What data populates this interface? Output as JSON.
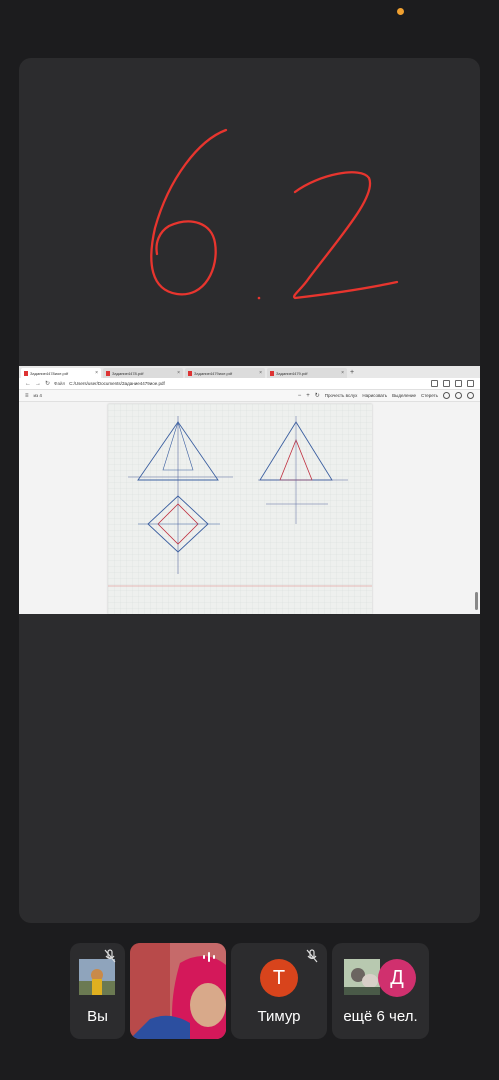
{
  "browser": {
    "tabs": [
      {
        "title": "Задание4478иое.pdf",
        "active": true
      },
      {
        "title": "Задание4478.pdf",
        "active": false
      },
      {
        "title": "Задание4479иое.pdf",
        "active": false
      },
      {
        "title": "Задание4479.pdf",
        "active": false
      }
    ],
    "address_label": "Файл",
    "address_url": "C:/Users/user/Documents/Задание4479иое.pdf",
    "pdf_toolbar": {
      "page_indicator": "из 4",
      "read_aloud": "Прочесть вслух",
      "draw": "Нарисовать",
      "highlight": "Выделение",
      "erase": "Стереть"
    }
  },
  "handwriting": {
    "text": "6 2",
    "color": "#e8352e"
  },
  "participants": [
    {
      "name": "Вы",
      "muted": true
    },
    {
      "name": "",
      "muted": false
    },
    {
      "name": "Тимур",
      "initial": "Т",
      "muted": true,
      "color": "#d8441c"
    },
    {
      "name": "ещё 6 чел.",
      "initial": "Д",
      "color": "#d0306e"
    }
  ]
}
